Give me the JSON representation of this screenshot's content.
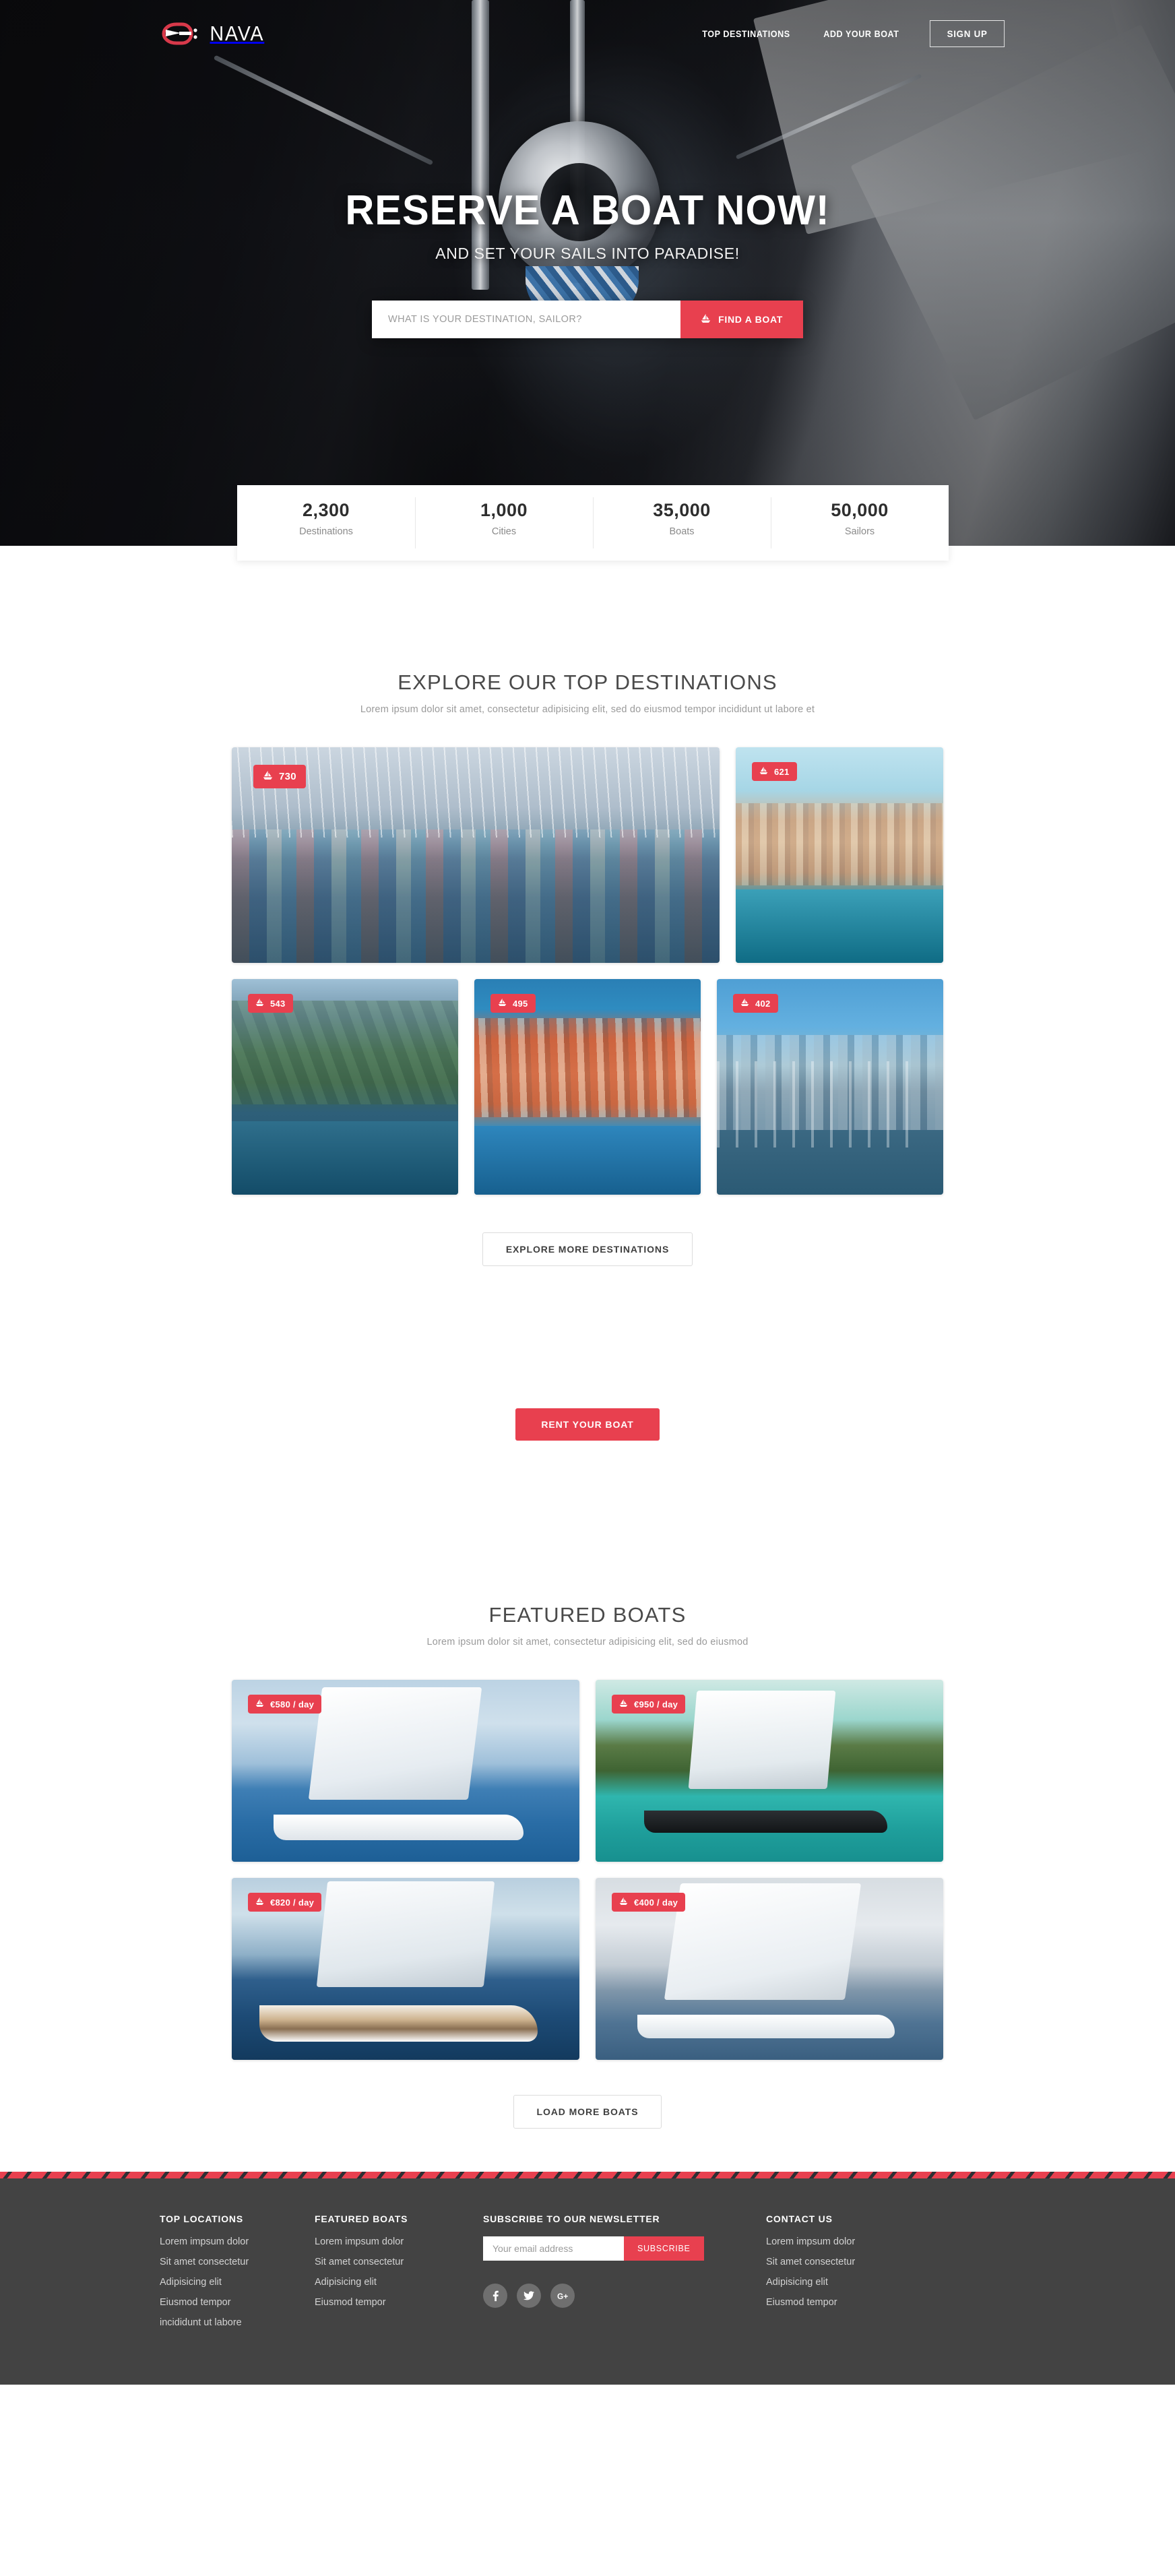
{
  "header": {
    "logo_text": "NAVA",
    "logo_icon": "nava-anchor-logo-icon",
    "nav": [
      {
        "label": "TOP DESTINATIONS",
        "name": "nav-top-destinations"
      },
      {
        "label": "ADD YOUR BOAT",
        "name": "nav-add-your-boat"
      }
    ],
    "signup_label": "SIGN UP"
  },
  "hero": {
    "title": "RESERVE A BOAT NOW!",
    "subtitle": "AND SET YOUR SAILS INTO PARADISE!",
    "search_placeholder": "WHAT IS YOUR DESTINATION, SAILOR?",
    "search_value": "",
    "find_button_label": "FIND A BOAT",
    "find_button_icon": "sailboat-icon"
  },
  "stats": [
    {
      "value": "2,300",
      "label": "Destinations"
    },
    {
      "value": "1,000",
      "label": "Cities"
    },
    {
      "value": "35,000",
      "label": "Boats"
    },
    {
      "value": "50,000",
      "label": "Sailors"
    }
  ],
  "destinations": {
    "title": "EXPLORE OUR TOP DESTINATIONS",
    "subtitle": "Lorem ipsum dolor sit amet, consectetur adipisicing elit, sed do eiusmod tempor incididunt ut labore et",
    "cards": [
      {
        "count": "730",
        "icon": "sailboat-icon"
      },
      {
        "count": "621",
        "icon": "sailboat-icon"
      },
      {
        "count": "543",
        "icon": "sailboat-icon"
      },
      {
        "count": "495",
        "icon": "sailboat-icon"
      },
      {
        "count": "402",
        "icon": "sailboat-icon"
      }
    ],
    "more_button_label": "EXPLORE MORE DESTINATIONS"
  },
  "rent": {
    "button_label": "RENT YOUR BOAT"
  },
  "featured": {
    "title": "FEATURED BOATS",
    "subtitle": "Lorem ipsum dolor sit amet, consectetur adipisicing elit, sed do eiusmod",
    "boats": [
      {
        "price": "€580 / day",
        "icon": "sailboat-icon"
      },
      {
        "price": "€950 / day",
        "icon": "sailboat-icon"
      },
      {
        "price": "€820 / day",
        "icon": "sailboat-icon"
      },
      {
        "price": "€400 / day",
        "icon": "sailboat-icon"
      }
    ],
    "more_button_label": "LOAD MORE BOATS"
  },
  "footer": {
    "top_locations": {
      "title": "TOP LOCATIONS",
      "links": [
        "Lorem impsum dolor",
        "Sit amet consectetur",
        "Adipisicing elit",
        "Eiusmod tempor",
        "incididunt ut labore"
      ]
    },
    "featured_boats": {
      "title": "FEATURED BOATS",
      "links": [
        "Lorem impsum dolor",
        "Sit amet consectetur",
        "Adipisicing elit",
        "Eiusmod tempor"
      ]
    },
    "newsletter": {
      "title": "SUBSCRIBE TO OUR NEWSLETTER",
      "placeholder": "Your email address",
      "value": "",
      "button_label": "SUBSCRIBE",
      "socials": [
        {
          "name": "facebook-icon",
          "glyph": "f"
        },
        {
          "name": "twitter-icon",
          "glyph": "t"
        },
        {
          "name": "google-plus-icon",
          "glyph": "G+"
        }
      ]
    },
    "contact": {
      "title": "CONTACT US",
      "links": [
        "Lorem impsum dolor",
        "Sit amet consectetur",
        "Adipisicing elit",
        "Eiusmod tempor"
      ]
    }
  },
  "colors": {
    "accent": "#e8404f",
    "footer_bg": "#434343",
    "text_dark": "#4a4a4a",
    "text_muted": "#9a9a9a"
  }
}
